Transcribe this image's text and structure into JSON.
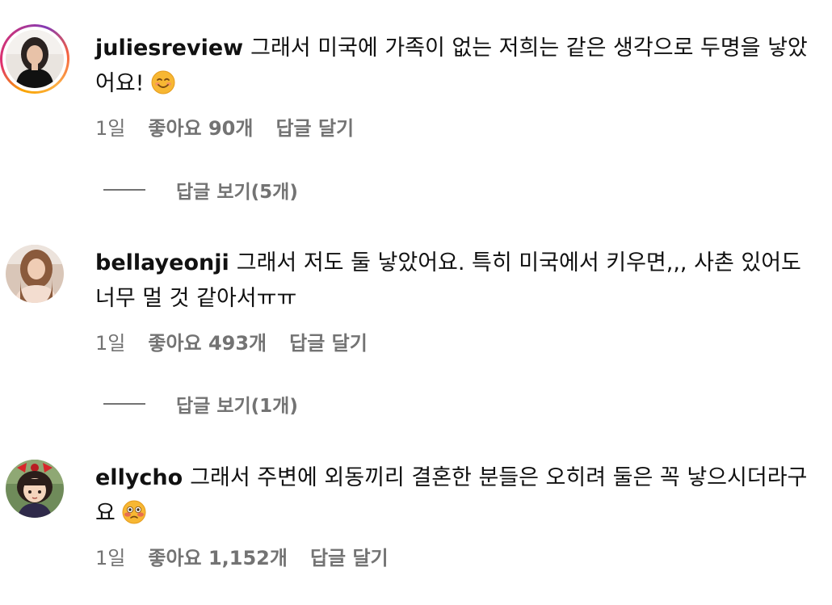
{
  "comments": [
    {
      "username": "juliesreview",
      "text": "그래서 미국에 가족이 없는 저희는 같은 생각으로 두명을 낳았어요!",
      "emoji": "smiling-face-emoji",
      "time": "1일",
      "likes": "좋아요 90개",
      "reply_label": "답글 달기",
      "view_replies": "답글 보기(5개)",
      "avatar_ring_color": "#e1306c"
    },
    {
      "username": "bellayeonji",
      "text": "그래서 저도 둘 낳았어요. 특히 미국에서 키우면,,, 사촌 있어도 너무 멀 것 같아서ㅠㅠ",
      "time": "1일",
      "likes": "좋아요 493개",
      "reply_label": "답글 달기",
      "view_replies": "답글 보기(1개)"
    },
    {
      "username": "ellycho",
      "text": "그래서 주변에 외동끼리 결혼한 분들은 오히려 둘은 꼭 낳으시더라구요",
      "emoji": "flushed-face-emoji",
      "time": "1일",
      "likes": "좋아요 1,152개",
      "reply_label": "답글 달기"
    }
  ]
}
